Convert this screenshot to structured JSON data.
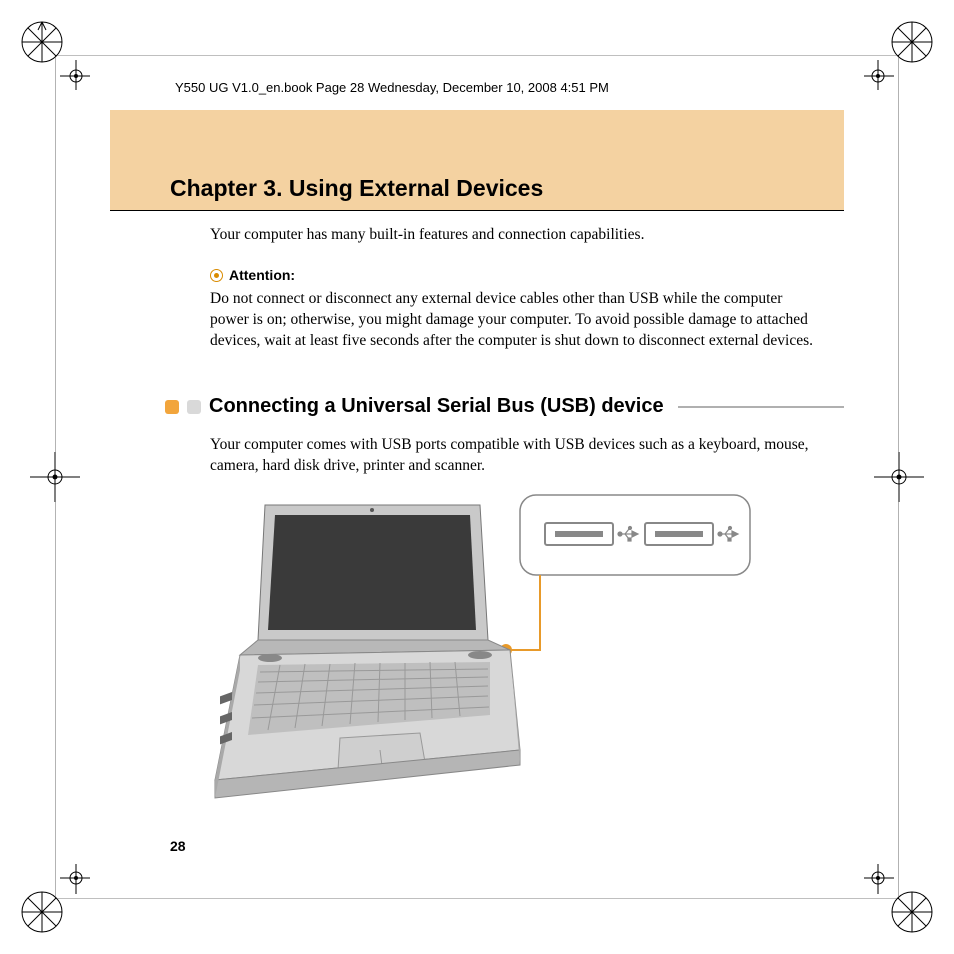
{
  "header_meta": "Y550 UG V1.0_en.book  Page 28  Wednesday, December 10, 2008  4:51 PM",
  "chapter_title": "Chapter 3. Using External Devices",
  "intro": "Your computer has many built-in features and connection capabilities.",
  "attention_label": "Attention:",
  "attention_body": "Do not connect or disconnect any external device cables other than USB while the computer power is on; otherwise, you might damage your computer. To avoid possible damage to attached devices, wait at least five seconds after the computer is shut down to disconnect external devices.",
  "section_heading": "Connecting a Universal Serial Bus (USB) device",
  "section_body": "Your computer comes with USB ports compatible with USB devices such as a keyboard, mouse, camera, hard disk drive, printer and scanner.",
  "page_number": "28"
}
